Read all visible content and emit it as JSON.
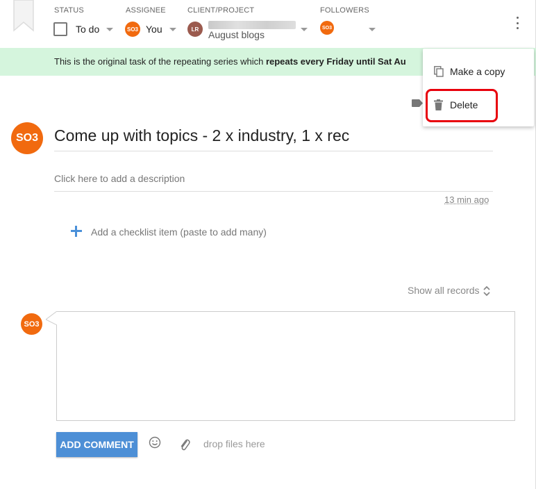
{
  "header": {
    "status": {
      "label": "STATUS",
      "value": "To do"
    },
    "assignee": {
      "label": "ASSIGNEE",
      "avatar": "SO3",
      "value": "You"
    },
    "client_project": {
      "label": "CLIENT/PROJECT",
      "avatar": "LR",
      "value": "August blogs"
    },
    "followers": {
      "label": "FOLLOWERS",
      "avatar": "SO3"
    },
    "more_icon": "vertical-dots-icon"
  },
  "banner": {
    "prefix": "This is the original task of the repeating series which ",
    "bold": "repeats every Friday until Sat Au"
  },
  "menu": {
    "items": [
      {
        "label": "Make a copy",
        "icon": "copy-icon"
      },
      {
        "label": "Delete",
        "icon": "trash-icon"
      }
    ]
  },
  "task": {
    "avatar": "SO3",
    "title": "Come up with topics - 2 x industry, 1 x rec",
    "description_placeholder": "Click here to add a description",
    "time_ago": "13 min ago",
    "checklist_placeholder": "Add a checklist item (paste to add many)"
  },
  "records": {
    "show_all": "Show all records"
  },
  "comment": {
    "avatar": "SO3",
    "button": "ADD COMMENT",
    "drop_text": "drop files here"
  },
  "colors": {
    "avatar_orange": "#f16a0f",
    "banner_green": "#d5f5dd",
    "button_blue": "#4d8fd6",
    "highlight_red": "#e8000c"
  }
}
